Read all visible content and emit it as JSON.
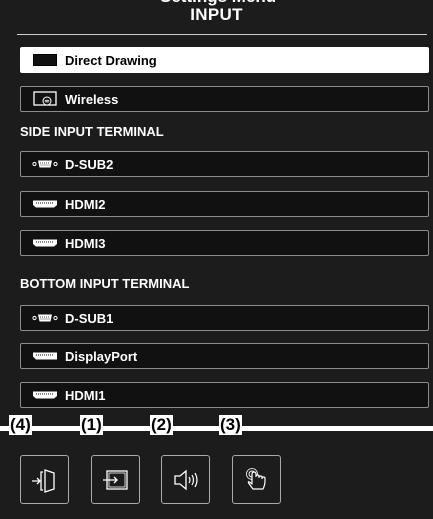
{
  "window": {
    "title": "INPUT"
  },
  "inputs": {
    "primary": [
      {
        "label": "Direct Drawing",
        "icon": "monitor-icon",
        "selected": true
      },
      {
        "label": "Wireless",
        "icon": "wireless-display-icon",
        "selected": false
      }
    ],
    "side": {
      "heading": "SIDE INPUT TERMINAL",
      "items": [
        {
          "label": "D-SUB2",
          "icon": "dsub-connector-icon"
        },
        {
          "label": "HDMI2",
          "icon": "hdmi-connector-icon"
        },
        {
          "label": "HDMI3",
          "icon": "hdmi-connector-icon"
        }
      ]
    },
    "bottom": {
      "heading": "BOTTOM INPUT TERMINAL",
      "items": [
        {
          "label": "D-SUB1",
          "icon": "dsub-connector-icon"
        },
        {
          "label": "DisplayPort",
          "icon": "displayport-connector-icon"
        },
        {
          "label": "HDMI1",
          "icon": "hdmi-connector-icon"
        }
      ]
    }
  },
  "callouts": {
    "c4": "(4)",
    "c1": "(1)",
    "c2": "(2)",
    "c3": "(3)"
  },
  "toolbar": [
    {
      "callout": "(4)",
      "icon": "exit-icon"
    },
    {
      "callout": "(1)",
      "icon": "input-switch-icon"
    },
    {
      "callout": "(2)",
      "icon": "volume-icon"
    },
    {
      "callout": "(3)",
      "icon": "touch-icon"
    }
  ],
  "colors": {
    "background": "#1c1c1c",
    "button": "#111111",
    "border": "#8c8c8c",
    "selected": "#ffffff"
  }
}
